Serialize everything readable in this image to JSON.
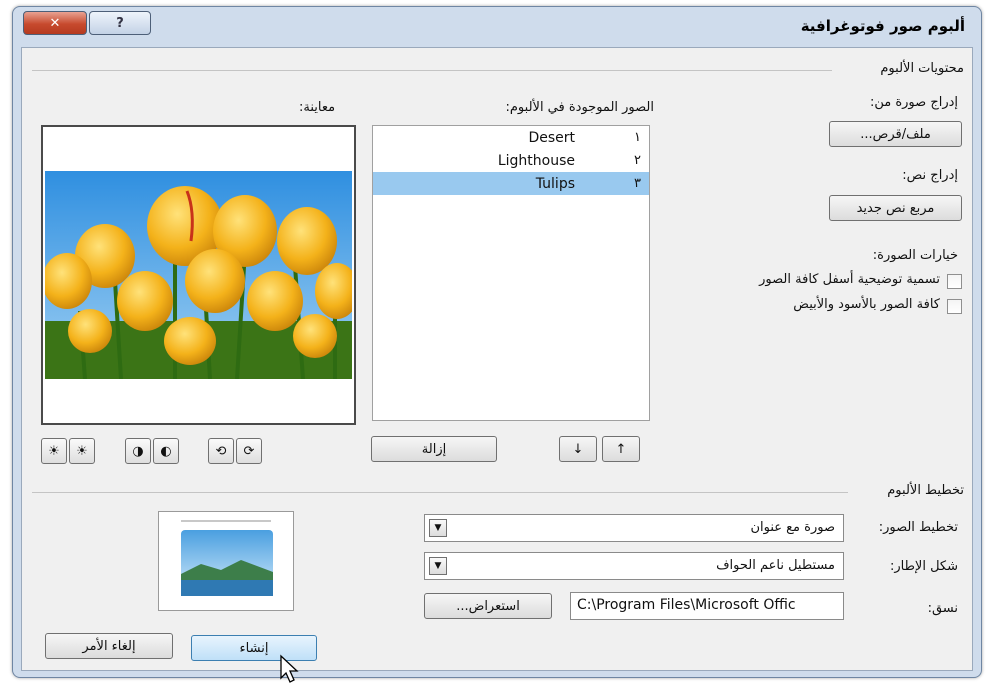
{
  "window": {
    "title": "ألبوم صور فوتوغرافية",
    "close_glyph": "✕",
    "help_glyph": "?"
  },
  "contents": {
    "group_title": "محتويات الألبوم",
    "insert_from_label": "إدراج صورة من:",
    "file_disk_button": "ملف/قرص...",
    "insert_text_label": "إدراج نص:",
    "new_textbox_button": "مربع نص جديد",
    "options_label": "خيارات الصورة:",
    "caption_option": "تسمية توضيحية أسفل كافة الصور",
    "bw_option": "كافة الصور بالأسود والأبيض",
    "list_label": "الصور الموجودة في الألبوم:",
    "pictures": [
      {
        "num": "١",
        "name": "Desert",
        "selected": false
      },
      {
        "num": "٢",
        "name": "Lighthouse",
        "selected": false
      },
      {
        "num": "٣",
        "name": "Tulips",
        "selected": true
      }
    ],
    "remove_button": "إزالة",
    "move_up_glyph": "↑",
    "move_down_glyph": "↓",
    "preview_label": "معاينة:"
  },
  "layout": {
    "group_title": "تخطيط الألبوم",
    "picture_layout_label": "تخطيط الصور:",
    "picture_layout_value": "صورة مع عنوان",
    "frame_shape_label": "شكل الإطار:",
    "frame_shape_value": "مستطيل ناعم الحواف",
    "theme_label": "نسق:",
    "theme_path": "C:\\Program Files\\Microsoft Offic",
    "browse_button": "استعراض...",
    "dropdown_glyph": "▼"
  },
  "footer": {
    "create_button": "إنشاء",
    "cancel_button": "إلغاء الأمر"
  },
  "colors": {
    "selection": "#99c9ef",
    "sky": "#3f9be0",
    "tulip": "#f2b81c",
    "stem": "#2e6b12"
  }
}
